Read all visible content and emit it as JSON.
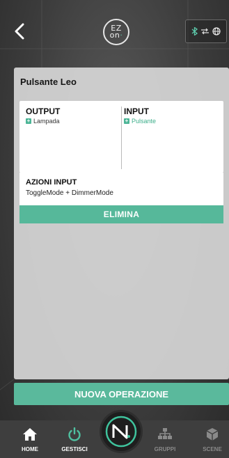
{
  "header": {
    "logo_top": "EZ",
    "logo_bottom": "on"
  },
  "panel": {
    "title": "Pulsante Leo",
    "output": {
      "heading": "OUTPUT",
      "item": "Lampada"
    },
    "input": {
      "heading": "INPUT",
      "item": "Pulsante"
    },
    "actions": {
      "heading": "AZIONI INPUT",
      "value": "ToggleMode + DimmerMode"
    },
    "delete_label": "ELIMINA"
  },
  "new_operation_label": "NUOVA OPERAZIONE",
  "nav": {
    "home": "HOME",
    "gestisci": "GESTISCI",
    "gruppi": "GRUPPI",
    "scene": "SCENE"
  },
  "colors": {
    "accent": "#56b89a",
    "panel": "#d7d7d7",
    "nav_bg": "#3e3e3e"
  },
  "icons": {
    "back": "chevron-left-icon",
    "bluetooth": "bluetooth-icon",
    "transfer": "transfer-arrows-icon",
    "globe": "globe-icon",
    "home": "home-icon",
    "power": "power-icon",
    "center": "ezon-hub-icon",
    "groups": "hierarchy-icon",
    "scene": "cube-icon"
  }
}
